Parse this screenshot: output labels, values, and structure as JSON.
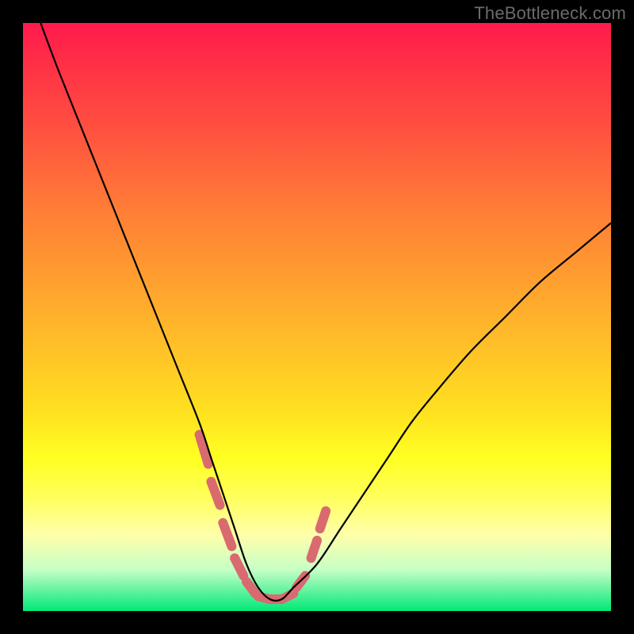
{
  "watermark": "TheBottleneck.com",
  "colors": {
    "background": "#000000",
    "curve": "#000000",
    "highlight": "#d96a6f",
    "gradient_top": "#ff1a4d",
    "gradient_bottom": "#00e878"
  },
  "chart_data": {
    "type": "line",
    "title": "",
    "xlabel": "",
    "ylabel": "",
    "xlim": [
      0,
      100
    ],
    "ylim": [
      0,
      100
    ],
    "grid": false,
    "x": [
      3,
      6,
      10,
      14,
      18,
      22,
      26,
      30,
      32,
      34,
      36,
      38,
      40,
      42,
      44,
      46,
      50,
      54,
      58,
      62,
      66,
      70,
      76,
      82,
      88,
      94,
      100
    ],
    "values": [
      100,
      92,
      82,
      72,
      62,
      52,
      42,
      32,
      26,
      20,
      14,
      8,
      4,
      2,
      2,
      4,
      8,
      14,
      20,
      26,
      32,
      37,
      44,
      50,
      56,
      61,
      66
    ],
    "note": "Values are relative Y positions (0=bottom green, 100=top red). Minimum (optimum) at x≈42–44.",
    "highlight_segments": [
      {
        "x0": 30,
        "y0": 30,
        "x1": 31.5,
        "y1": 25
      },
      {
        "x0": 32,
        "y0": 22,
        "x1": 33.5,
        "y1": 18
      },
      {
        "x0": 34,
        "y0": 15,
        "x1": 35.5,
        "y1": 11
      },
      {
        "x0": 36,
        "y0": 9,
        "x1": 37.5,
        "y1": 6
      },
      {
        "x0": 38,
        "y0": 5,
        "x1": 39.5,
        "y1": 3
      },
      {
        "x0": 40,
        "y0": 2.5,
        "x1": 42,
        "y1": 2
      },
      {
        "x0": 42,
        "y0": 2,
        "x1": 44,
        "y1": 2
      },
      {
        "x0": 44,
        "y0": 2,
        "x1": 46,
        "y1": 3
      },
      {
        "x0": 46.5,
        "y0": 4,
        "x1": 48,
        "y1": 6
      },
      {
        "x0": 49,
        "y0": 9,
        "x1": 50,
        "y1": 12
      },
      {
        "x0": 50.5,
        "y0": 14,
        "x1": 51.5,
        "y1": 17
      }
    ]
  }
}
